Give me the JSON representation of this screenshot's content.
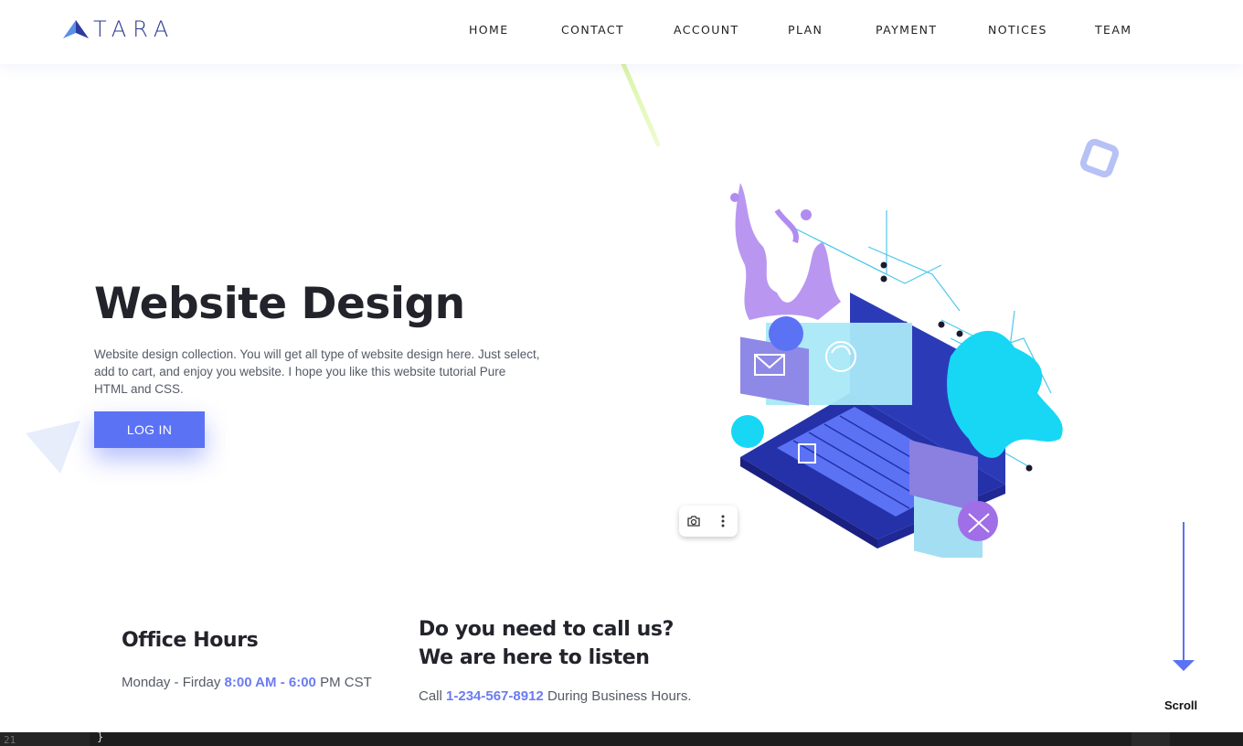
{
  "header": {
    "logo_text": "TARA",
    "nav": [
      {
        "id": "home",
        "label": "HOME"
      },
      {
        "id": "contact",
        "label": "CONTACT"
      },
      {
        "id": "account",
        "label": "ACCOUNT"
      },
      {
        "id": "plan",
        "label": "PLAN"
      },
      {
        "id": "payment",
        "label": "PAYMENT"
      },
      {
        "id": "notices",
        "label": "NOTICES"
      },
      {
        "id": "team",
        "label": "TEAM"
      }
    ]
  },
  "hero": {
    "title": "Website Design",
    "description": "Website design collection. You will get all type of website design here. Just select, add to cart, and enjoy you website. I hope you like this website tutorial Pure HTML and CSS.",
    "login_label": "LOG IN",
    "illustration_icon": "laptop-illustration"
  },
  "image_tools": {
    "camera_icon": "camera-icon",
    "more_icon": "more-vertical-icon"
  },
  "office": {
    "title": "Office Hours",
    "days": "Monday - Firday",
    "time_start": "8:00 AM",
    "sep": "-",
    "time_end": "6:00",
    "suffix": "PM CST"
  },
  "call": {
    "title_line1": "Do you need to call us?",
    "title_line2": "We are here to listen",
    "prefix": "Call",
    "phone": "1-234-567-8912",
    "suffix": "During Business Hours."
  },
  "scroll": {
    "label": "Scroll"
  },
  "editor_strip": {
    "line_number": "21",
    "code": "}"
  },
  "colors": {
    "accent": "#5b72f5",
    "highlight": "#6b7cf0",
    "heading": "#23242b",
    "body_text": "#555a66",
    "logo": "#2b3a8f"
  }
}
